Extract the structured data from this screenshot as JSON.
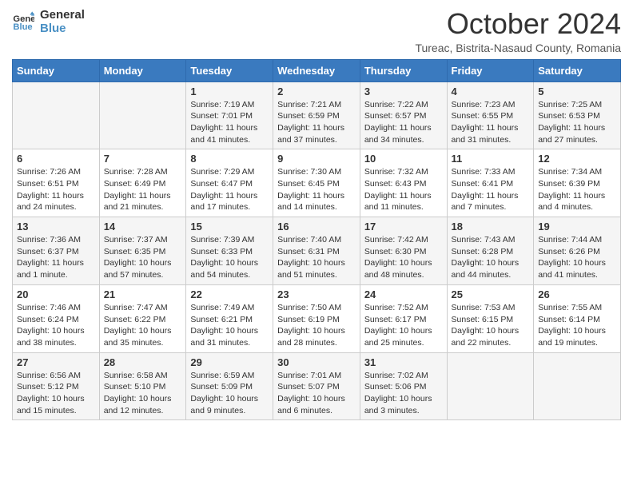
{
  "header": {
    "logo_line1": "General",
    "logo_line2": "Blue",
    "month": "October 2024",
    "location": "Tureac, Bistrita-Nasaud County, Romania"
  },
  "weekdays": [
    "Sunday",
    "Monday",
    "Tuesday",
    "Wednesday",
    "Thursday",
    "Friday",
    "Saturday"
  ],
  "weeks": [
    [
      {
        "day": "",
        "sunrise": "",
        "sunset": "",
        "daylight": ""
      },
      {
        "day": "",
        "sunrise": "",
        "sunset": "",
        "daylight": ""
      },
      {
        "day": "1",
        "sunrise": "Sunrise: 7:19 AM",
        "sunset": "Sunset: 7:01 PM",
        "daylight": "Daylight: 11 hours and 41 minutes."
      },
      {
        "day": "2",
        "sunrise": "Sunrise: 7:21 AM",
        "sunset": "Sunset: 6:59 PM",
        "daylight": "Daylight: 11 hours and 37 minutes."
      },
      {
        "day": "3",
        "sunrise": "Sunrise: 7:22 AM",
        "sunset": "Sunset: 6:57 PM",
        "daylight": "Daylight: 11 hours and 34 minutes."
      },
      {
        "day": "4",
        "sunrise": "Sunrise: 7:23 AM",
        "sunset": "Sunset: 6:55 PM",
        "daylight": "Daylight: 11 hours and 31 minutes."
      },
      {
        "day": "5",
        "sunrise": "Sunrise: 7:25 AM",
        "sunset": "Sunset: 6:53 PM",
        "daylight": "Daylight: 11 hours and 27 minutes."
      }
    ],
    [
      {
        "day": "6",
        "sunrise": "Sunrise: 7:26 AM",
        "sunset": "Sunset: 6:51 PM",
        "daylight": "Daylight: 11 hours and 24 minutes."
      },
      {
        "day": "7",
        "sunrise": "Sunrise: 7:28 AM",
        "sunset": "Sunset: 6:49 PM",
        "daylight": "Daylight: 11 hours and 21 minutes."
      },
      {
        "day": "8",
        "sunrise": "Sunrise: 7:29 AM",
        "sunset": "Sunset: 6:47 PM",
        "daylight": "Daylight: 11 hours and 17 minutes."
      },
      {
        "day": "9",
        "sunrise": "Sunrise: 7:30 AM",
        "sunset": "Sunset: 6:45 PM",
        "daylight": "Daylight: 11 hours and 14 minutes."
      },
      {
        "day": "10",
        "sunrise": "Sunrise: 7:32 AM",
        "sunset": "Sunset: 6:43 PM",
        "daylight": "Daylight: 11 hours and 11 minutes."
      },
      {
        "day": "11",
        "sunrise": "Sunrise: 7:33 AM",
        "sunset": "Sunset: 6:41 PM",
        "daylight": "Daylight: 11 hours and 7 minutes."
      },
      {
        "day": "12",
        "sunrise": "Sunrise: 7:34 AM",
        "sunset": "Sunset: 6:39 PM",
        "daylight": "Daylight: 11 hours and 4 minutes."
      }
    ],
    [
      {
        "day": "13",
        "sunrise": "Sunrise: 7:36 AM",
        "sunset": "Sunset: 6:37 PM",
        "daylight": "Daylight: 11 hours and 1 minute."
      },
      {
        "day": "14",
        "sunrise": "Sunrise: 7:37 AM",
        "sunset": "Sunset: 6:35 PM",
        "daylight": "Daylight: 10 hours and 57 minutes."
      },
      {
        "day": "15",
        "sunrise": "Sunrise: 7:39 AM",
        "sunset": "Sunset: 6:33 PM",
        "daylight": "Daylight: 10 hours and 54 minutes."
      },
      {
        "day": "16",
        "sunrise": "Sunrise: 7:40 AM",
        "sunset": "Sunset: 6:31 PM",
        "daylight": "Daylight: 10 hours and 51 minutes."
      },
      {
        "day": "17",
        "sunrise": "Sunrise: 7:42 AM",
        "sunset": "Sunset: 6:30 PM",
        "daylight": "Daylight: 10 hours and 48 minutes."
      },
      {
        "day": "18",
        "sunrise": "Sunrise: 7:43 AM",
        "sunset": "Sunset: 6:28 PM",
        "daylight": "Daylight: 10 hours and 44 minutes."
      },
      {
        "day": "19",
        "sunrise": "Sunrise: 7:44 AM",
        "sunset": "Sunset: 6:26 PM",
        "daylight": "Daylight: 10 hours and 41 minutes."
      }
    ],
    [
      {
        "day": "20",
        "sunrise": "Sunrise: 7:46 AM",
        "sunset": "Sunset: 6:24 PM",
        "daylight": "Daylight: 10 hours and 38 minutes."
      },
      {
        "day": "21",
        "sunrise": "Sunrise: 7:47 AM",
        "sunset": "Sunset: 6:22 PM",
        "daylight": "Daylight: 10 hours and 35 minutes."
      },
      {
        "day": "22",
        "sunrise": "Sunrise: 7:49 AM",
        "sunset": "Sunset: 6:21 PM",
        "daylight": "Daylight: 10 hours and 31 minutes."
      },
      {
        "day": "23",
        "sunrise": "Sunrise: 7:50 AM",
        "sunset": "Sunset: 6:19 PM",
        "daylight": "Daylight: 10 hours and 28 minutes."
      },
      {
        "day": "24",
        "sunrise": "Sunrise: 7:52 AM",
        "sunset": "Sunset: 6:17 PM",
        "daylight": "Daylight: 10 hours and 25 minutes."
      },
      {
        "day": "25",
        "sunrise": "Sunrise: 7:53 AM",
        "sunset": "Sunset: 6:15 PM",
        "daylight": "Daylight: 10 hours and 22 minutes."
      },
      {
        "day": "26",
        "sunrise": "Sunrise: 7:55 AM",
        "sunset": "Sunset: 6:14 PM",
        "daylight": "Daylight: 10 hours and 19 minutes."
      }
    ],
    [
      {
        "day": "27",
        "sunrise": "Sunrise: 6:56 AM",
        "sunset": "Sunset: 5:12 PM",
        "daylight": "Daylight: 10 hours and 15 minutes."
      },
      {
        "day": "28",
        "sunrise": "Sunrise: 6:58 AM",
        "sunset": "Sunset: 5:10 PM",
        "daylight": "Daylight: 10 hours and 12 minutes."
      },
      {
        "day": "29",
        "sunrise": "Sunrise: 6:59 AM",
        "sunset": "Sunset: 5:09 PM",
        "daylight": "Daylight: 10 hours and 9 minutes."
      },
      {
        "day": "30",
        "sunrise": "Sunrise: 7:01 AM",
        "sunset": "Sunset: 5:07 PM",
        "daylight": "Daylight: 10 hours and 6 minutes."
      },
      {
        "day": "31",
        "sunrise": "Sunrise: 7:02 AM",
        "sunset": "Sunset: 5:06 PM",
        "daylight": "Daylight: 10 hours and 3 minutes."
      },
      {
        "day": "",
        "sunrise": "",
        "sunset": "",
        "daylight": ""
      },
      {
        "day": "",
        "sunrise": "",
        "sunset": "",
        "daylight": ""
      }
    ]
  ]
}
